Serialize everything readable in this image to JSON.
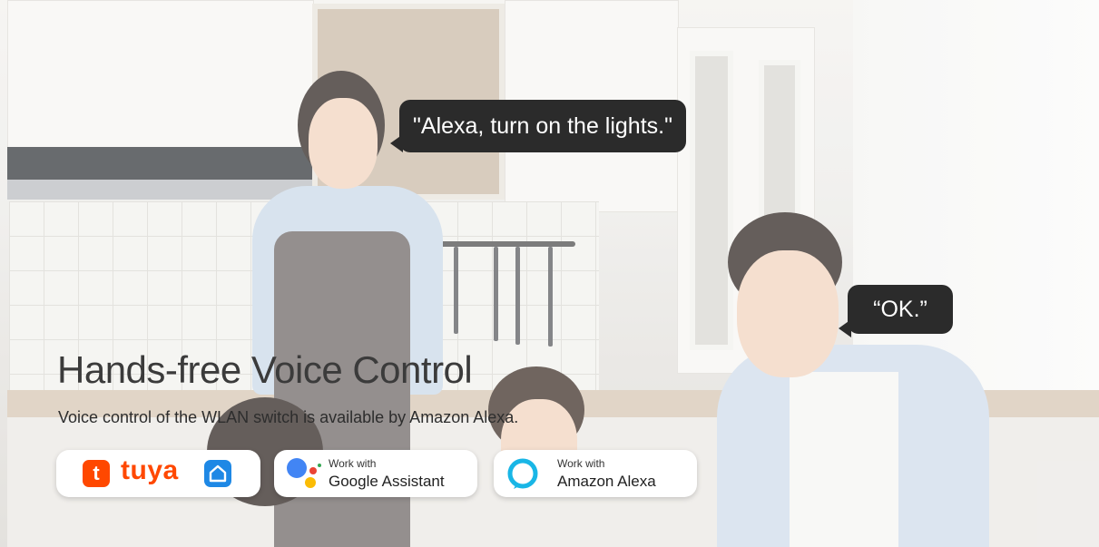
{
  "speech": {
    "woman": "\"Alexa, turn on the lights.\"",
    "man": "“OK.”"
  },
  "headline": "Hands-free Voice Control",
  "subline": "Voice control of the WLAN switch is available by Amazon Alexa.",
  "badges": {
    "tuya": {
      "brand": "tuya",
      "logo_glyph": "t",
      "icons": [
        "tuya-logo-icon",
        "smart-home-icon"
      ]
    },
    "google": {
      "small": "Work with",
      "big": "Google Assistant",
      "icon": "google-assistant-icon"
    },
    "alexa": {
      "small": "Work with",
      "big": "Amazon Alexa",
      "icon": "alexa-ring-icon"
    }
  },
  "colors": {
    "tuya_orange": "#ff4800",
    "home_blue": "#1e88e5",
    "alexa_cyan": "#19b6e6",
    "bubble": "#2b2b2b"
  }
}
